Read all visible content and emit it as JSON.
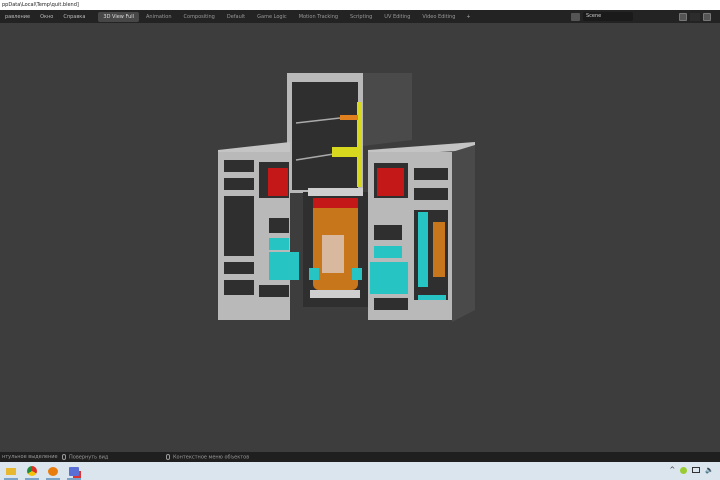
{
  "window": {
    "title": "ppData\\Local\\Temp\\quit.blend]"
  },
  "menu": [
    "равление",
    "Окно",
    "Справка"
  ],
  "tabs": [
    {
      "label": "3D View Full",
      "active": true
    },
    {
      "label": "Animation"
    },
    {
      "label": "Compositing"
    },
    {
      "label": "Default"
    },
    {
      "label": "Game Logic"
    },
    {
      "label": "Motion Tracking"
    },
    {
      "label": "Scripting"
    },
    {
      "label": "UV Editing"
    },
    {
      "label": "Video Editing"
    }
  ],
  "add_tab": "+",
  "scene": {
    "name": "Scene"
  },
  "status": {
    "left": "нтульное выделение",
    "middle": "Повернуть вид",
    "right": "Контекстное меню объектов"
  },
  "taskbar": {
    "apps": [
      "file-explorer-icon",
      "chrome-icon",
      "blender-icon",
      "snipping-tool-icon"
    ],
    "tray_up": "^"
  },
  "colors": {
    "viewport": "#3d3d3d",
    "model_gray": "#b9b9b9",
    "reactor": "#c8761c",
    "heat_red": "#c41818",
    "teal": "#27c4c4",
    "yellow": "#d8d81e"
  }
}
